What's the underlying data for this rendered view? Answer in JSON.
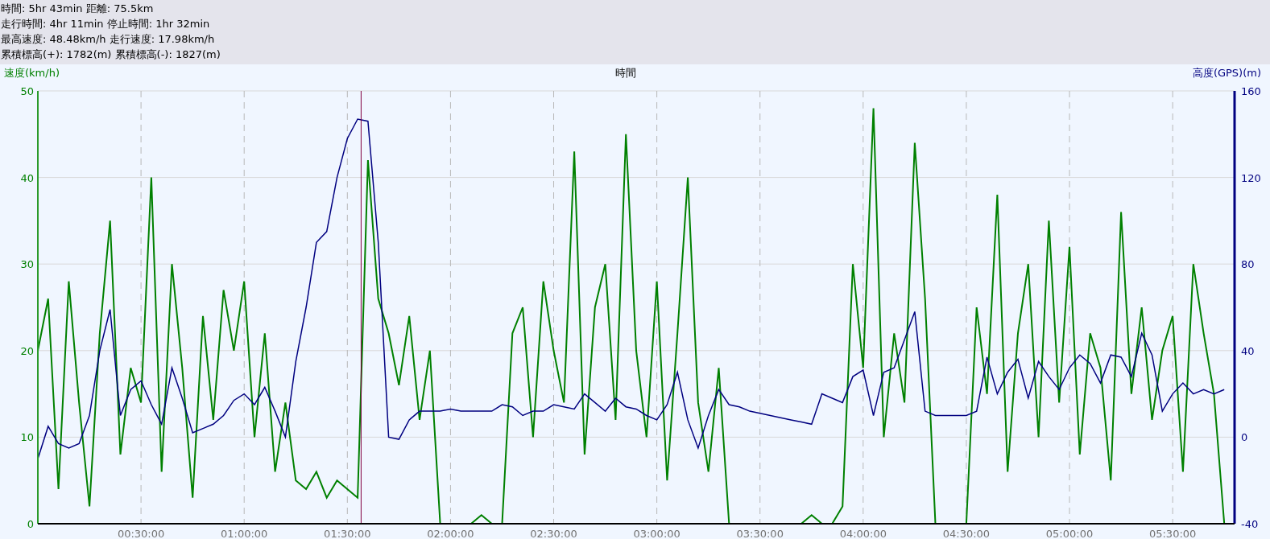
{
  "summary_lines": [
    "時間: 5hr 43min 距離: 75.5km",
    "走行時間: 4hr 11min 停止時間: 1hr 32min",
    "最高速度: 48.48km/h 走行速度: 17.98km/h",
    "累積標高(+): 1782(m) 累積標高(-): 1827(m)"
  ],
  "chart": {
    "chart_data": {
      "type": "line",
      "xlabel": "時間",
      "ylabel": "速度(km/h)",
      "y2label": "高度(GPS)(m)",
      "xlim": [
        0,
        348
      ],
      "ylim": [
        0,
        50
      ],
      "y2lim": [
        -40,
        160
      ],
      "xticks": [
        {
          "value": 30,
          "label": "00:30:00"
        },
        {
          "value": 60,
          "label": "01:00:00"
        },
        {
          "value": 90,
          "label": "01:30:00"
        },
        {
          "value": 120,
          "label": "02:00:00"
        },
        {
          "value": 150,
          "label": "02:30:00"
        },
        {
          "value": 180,
          "label": "03:00:00"
        },
        {
          "value": 210,
          "label": "03:30:00"
        },
        {
          "value": 240,
          "label": "04:00:00"
        },
        {
          "value": 270,
          "label": "04:30:00"
        },
        {
          "value": 300,
          "label": "05:00:00"
        },
        {
          "value": 330,
          "label": "05:30:00"
        }
      ],
      "yticks": [
        0,
        10,
        20,
        30,
        40,
        50
      ],
      "y2ticks": [
        -40,
        0,
        40,
        80,
        120,
        160
      ],
      "x": [
        0,
        3,
        6,
        9,
        12,
        15,
        18,
        21,
        24,
        27,
        30,
        33,
        36,
        39,
        42,
        45,
        48,
        51,
        54,
        57,
        60,
        63,
        66,
        69,
        72,
        75,
        78,
        81,
        84,
        87,
        90,
        93,
        96,
        99,
        102,
        105,
        108,
        111,
        114,
        117,
        120,
        123,
        126,
        129,
        132,
        135,
        138,
        141,
        144,
        147,
        150,
        153,
        156,
        159,
        162,
        165,
        168,
        171,
        174,
        177,
        180,
        183,
        186,
        189,
        192,
        195,
        198,
        201,
        204,
        207,
        210,
        213,
        216,
        219,
        222,
        225,
        228,
        231,
        234,
        237,
        240,
        243,
        246,
        249,
        252,
        255,
        258,
        261,
        264,
        267,
        270,
        273,
        276,
        279,
        282,
        285,
        288,
        291,
        294,
        297,
        300,
        303,
        306,
        309,
        312,
        315,
        318,
        321,
        324,
        327,
        330,
        333,
        336,
        339,
        342,
        345
      ],
      "series": [
        {
          "color": "#008000",
          "values": [
            20,
            26,
            4,
            28,
            14,
            2,
            22,
            35,
            8,
            18,
            14,
            40,
            6,
            30,
            18,
            3,
            24,
            12,
            27,
            20,
            28,
            10,
            22,
            6,
            14,
            5,
            4,
            6,
            3,
            5,
            4,
            3,
            42,
            26,
            22,
            16,
            24,
            12,
            20,
            0,
            0,
            0,
            0,
            1,
            0,
            0,
            22,
            25,
            10,
            28,
            20,
            14,
            43,
            8,
            25,
            30,
            12,
            45,
            20,
            10,
            28,
            5,
            22,
            40,
            14,
            6,
            18,
            0,
            0,
            0,
            0,
            0,
            0,
            0,
            0,
            1,
            0,
            0,
            2,
            30,
            18,
            48,
            10,
            22,
            14,
            44,
            26,
            0,
            0,
            0,
            0,
            25,
            15,
            38,
            6,
            22,
            30,
            10,
            35,
            14,
            32,
            8,
            22,
            18,
            5,
            36,
            15,
            25,
            12,
            20,
            24,
            6,
            30,
            22,
            15,
            0
          ]
        },
        {
          "color": "#000080",
          "axis": "y2",
          "values": [
            -10,
            5,
            -3,
            -5,
            -3,
            10,
            40,
            59,
            10,
            22,
            26,
            15,
            6,
            32,
            18,
            2,
            4,
            6,
            10,
            17,
            20,
            15,
            23,
            12,
            0,
            35,
            60,
            90,
            95,
            120,
            138,
            147,
            146,
            90,
            0,
            -1,
            8,
            12,
            12,
            12,
            13,
            12,
            12,
            12,
            12,
            15,
            14,
            10,
            12,
            12,
            15,
            14,
            13,
            20,
            16,
            12,
            18,
            14,
            13,
            10,
            8,
            15,
            30,
            8,
            -5,
            10,
            22,
            15,
            14,
            12,
            11,
            10,
            9,
            8,
            7,
            6,
            20,
            18,
            16,
            28,
            31,
            10,
            30,
            32,
            45,
            58,
            12,
            10,
            10,
            10,
            10,
            12,
            37,
            20,
            30,
            36,
            18,
            35,
            28,
            22,
            32,
            38,
            34,
            25,
            38,
            37,
            28,
            48,
            38,
            12,
            20,
            25,
            20,
            22,
            20,
            22
          ]
        }
      ],
      "grid": true,
      "ref_lines": [
        {
          "axis": "x",
          "value": 94,
          "color": "#800040"
        }
      ]
    }
  }
}
